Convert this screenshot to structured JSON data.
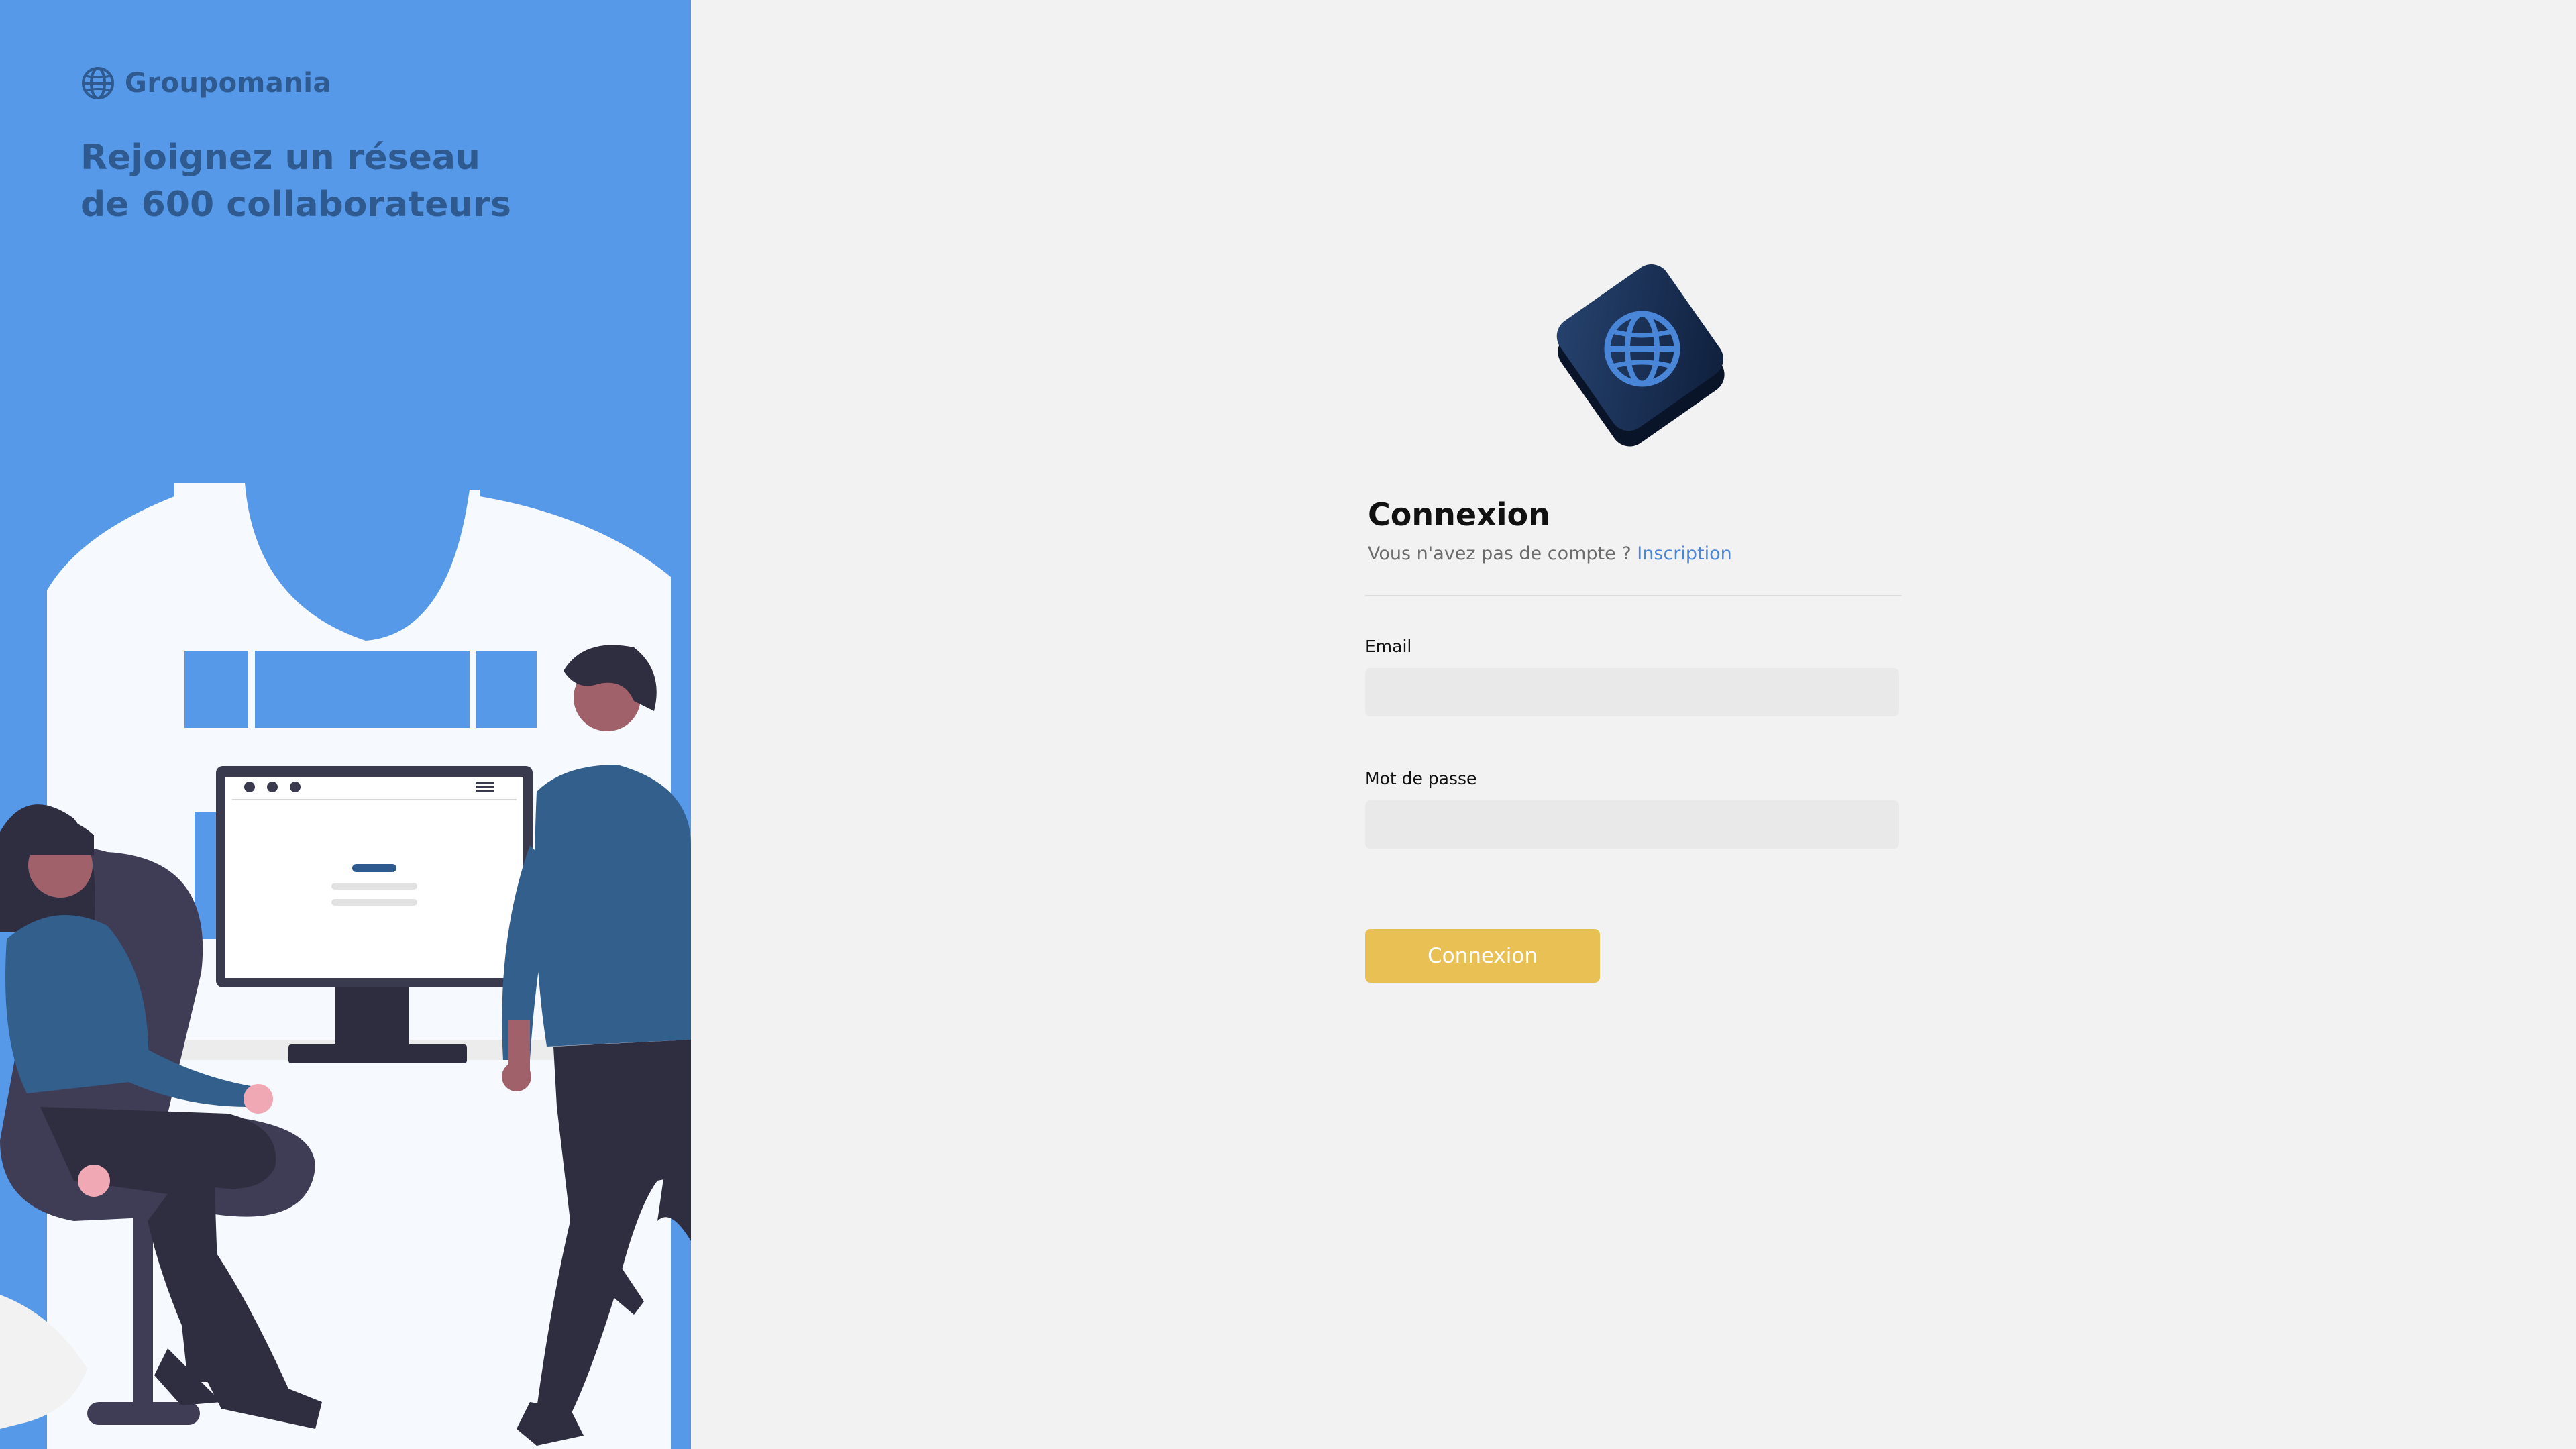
{
  "brand": {
    "name": "Groupomania",
    "icon": "globe-icon"
  },
  "tagline": {
    "line1": "Rejoignez un réseau",
    "line2": "de 600 collaborateurs"
  },
  "illustration": {
    "description_icon": "office-illustration"
  },
  "login": {
    "logo_icon": "globe-3d-icon",
    "title": "Connexion",
    "prompt": "Vous n'avez pas de compte ?",
    "signup_link": "Inscription",
    "email_label": "Email",
    "email_value": "",
    "password_label": "Mot de passe",
    "password_value": "",
    "submit_label": "Connexion"
  },
  "colors": {
    "left_panel": "#5699e9",
    "brand_text": "#2f5a8f",
    "right_panel": "#f2f2f2",
    "link": "#4a86d8",
    "submit_button": "#e8c053",
    "input_bg": "#e9e9e9"
  }
}
